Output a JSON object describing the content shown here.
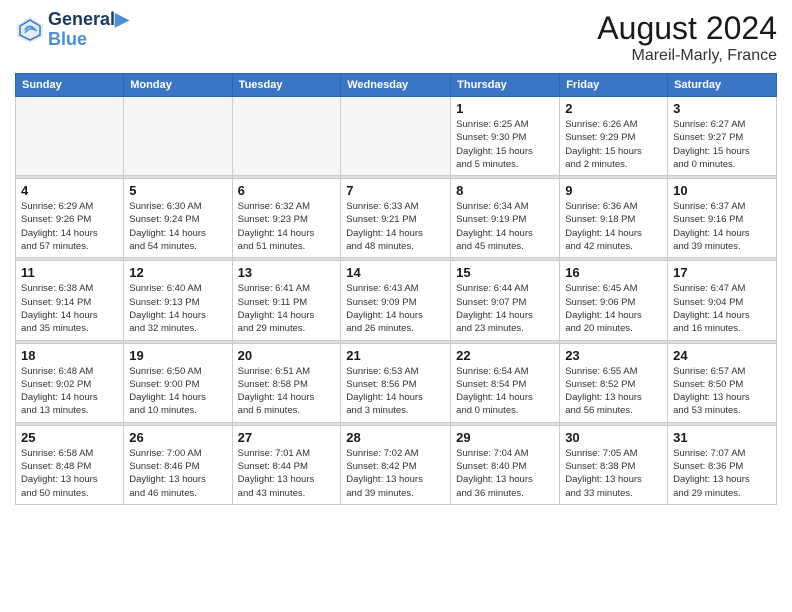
{
  "header": {
    "logo_line1": "General",
    "logo_line2": "Blue",
    "month_year": "August 2024",
    "location": "Mareil-Marly, France"
  },
  "days_of_week": [
    "Sunday",
    "Monday",
    "Tuesday",
    "Wednesday",
    "Thursday",
    "Friday",
    "Saturday"
  ],
  "weeks": [
    [
      {
        "day": "",
        "info": ""
      },
      {
        "day": "",
        "info": ""
      },
      {
        "day": "",
        "info": ""
      },
      {
        "day": "",
        "info": ""
      },
      {
        "day": "1",
        "info": "Sunrise: 6:25 AM\nSunset: 9:30 PM\nDaylight: 15 hours\nand 5 minutes."
      },
      {
        "day": "2",
        "info": "Sunrise: 6:26 AM\nSunset: 9:29 PM\nDaylight: 15 hours\nand 2 minutes."
      },
      {
        "day": "3",
        "info": "Sunrise: 6:27 AM\nSunset: 9:27 PM\nDaylight: 15 hours\nand 0 minutes."
      }
    ],
    [
      {
        "day": "4",
        "info": "Sunrise: 6:29 AM\nSunset: 9:26 PM\nDaylight: 14 hours\nand 57 minutes."
      },
      {
        "day": "5",
        "info": "Sunrise: 6:30 AM\nSunset: 9:24 PM\nDaylight: 14 hours\nand 54 minutes."
      },
      {
        "day": "6",
        "info": "Sunrise: 6:32 AM\nSunset: 9:23 PM\nDaylight: 14 hours\nand 51 minutes."
      },
      {
        "day": "7",
        "info": "Sunrise: 6:33 AM\nSunset: 9:21 PM\nDaylight: 14 hours\nand 48 minutes."
      },
      {
        "day": "8",
        "info": "Sunrise: 6:34 AM\nSunset: 9:19 PM\nDaylight: 14 hours\nand 45 minutes."
      },
      {
        "day": "9",
        "info": "Sunrise: 6:36 AM\nSunset: 9:18 PM\nDaylight: 14 hours\nand 42 minutes."
      },
      {
        "day": "10",
        "info": "Sunrise: 6:37 AM\nSunset: 9:16 PM\nDaylight: 14 hours\nand 39 minutes."
      }
    ],
    [
      {
        "day": "11",
        "info": "Sunrise: 6:38 AM\nSunset: 9:14 PM\nDaylight: 14 hours\nand 35 minutes."
      },
      {
        "day": "12",
        "info": "Sunrise: 6:40 AM\nSunset: 9:13 PM\nDaylight: 14 hours\nand 32 minutes."
      },
      {
        "day": "13",
        "info": "Sunrise: 6:41 AM\nSunset: 9:11 PM\nDaylight: 14 hours\nand 29 minutes."
      },
      {
        "day": "14",
        "info": "Sunrise: 6:43 AM\nSunset: 9:09 PM\nDaylight: 14 hours\nand 26 minutes."
      },
      {
        "day": "15",
        "info": "Sunrise: 6:44 AM\nSunset: 9:07 PM\nDaylight: 14 hours\nand 23 minutes."
      },
      {
        "day": "16",
        "info": "Sunrise: 6:45 AM\nSunset: 9:06 PM\nDaylight: 14 hours\nand 20 minutes."
      },
      {
        "day": "17",
        "info": "Sunrise: 6:47 AM\nSunset: 9:04 PM\nDaylight: 14 hours\nand 16 minutes."
      }
    ],
    [
      {
        "day": "18",
        "info": "Sunrise: 6:48 AM\nSunset: 9:02 PM\nDaylight: 14 hours\nand 13 minutes."
      },
      {
        "day": "19",
        "info": "Sunrise: 6:50 AM\nSunset: 9:00 PM\nDaylight: 14 hours\nand 10 minutes."
      },
      {
        "day": "20",
        "info": "Sunrise: 6:51 AM\nSunset: 8:58 PM\nDaylight: 14 hours\nand 6 minutes."
      },
      {
        "day": "21",
        "info": "Sunrise: 6:53 AM\nSunset: 8:56 PM\nDaylight: 14 hours\nand 3 minutes."
      },
      {
        "day": "22",
        "info": "Sunrise: 6:54 AM\nSunset: 8:54 PM\nDaylight: 14 hours\nand 0 minutes."
      },
      {
        "day": "23",
        "info": "Sunrise: 6:55 AM\nSunset: 8:52 PM\nDaylight: 13 hours\nand 56 minutes."
      },
      {
        "day": "24",
        "info": "Sunrise: 6:57 AM\nSunset: 8:50 PM\nDaylight: 13 hours\nand 53 minutes."
      }
    ],
    [
      {
        "day": "25",
        "info": "Sunrise: 6:58 AM\nSunset: 8:48 PM\nDaylight: 13 hours\nand 50 minutes."
      },
      {
        "day": "26",
        "info": "Sunrise: 7:00 AM\nSunset: 8:46 PM\nDaylight: 13 hours\nand 46 minutes."
      },
      {
        "day": "27",
        "info": "Sunrise: 7:01 AM\nSunset: 8:44 PM\nDaylight: 13 hours\nand 43 minutes."
      },
      {
        "day": "28",
        "info": "Sunrise: 7:02 AM\nSunset: 8:42 PM\nDaylight: 13 hours\nand 39 minutes."
      },
      {
        "day": "29",
        "info": "Sunrise: 7:04 AM\nSunset: 8:40 PM\nDaylight: 13 hours\nand 36 minutes."
      },
      {
        "day": "30",
        "info": "Sunrise: 7:05 AM\nSunset: 8:38 PM\nDaylight: 13 hours\nand 33 minutes."
      },
      {
        "day": "31",
        "info": "Sunrise: 7:07 AM\nSunset: 8:36 PM\nDaylight: 13 hours\nand 29 minutes."
      }
    ]
  ]
}
